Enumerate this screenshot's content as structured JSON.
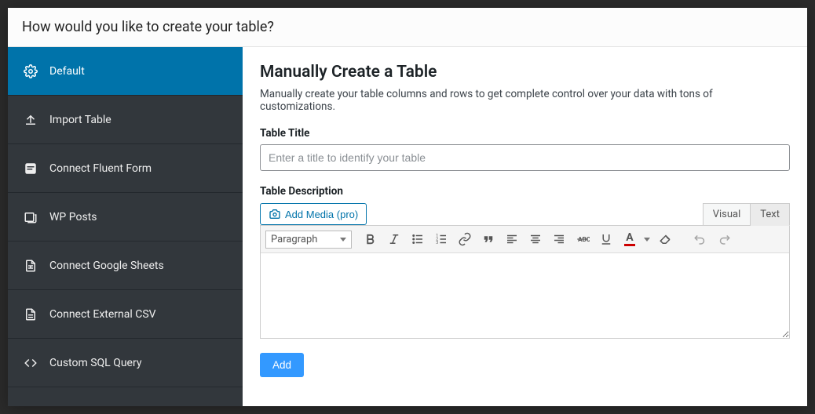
{
  "header": {
    "title": "How would you like to create your table?"
  },
  "sidebar": {
    "items": [
      {
        "label": "Default"
      },
      {
        "label": "Import Table"
      },
      {
        "label": "Connect Fluent Form"
      },
      {
        "label": "WP Posts"
      },
      {
        "label": "Connect Google Sheets"
      },
      {
        "label": "Connect External CSV"
      },
      {
        "label": "Custom SQL Query"
      }
    ]
  },
  "main": {
    "heading": "Manually Create a Table",
    "subtitle": "Manually create your table columns and rows to get complete control over your data with tons of customizations.",
    "title_label": "Table Title",
    "title_placeholder": "Enter a title to identify your table",
    "desc_label": "Table Description",
    "add_media_label": "Add Media (pro)",
    "tabs": {
      "visual": "Visual",
      "text": "Text"
    },
    "format_select": "Paragraph",
    "add_button": "Add"
  }
}
